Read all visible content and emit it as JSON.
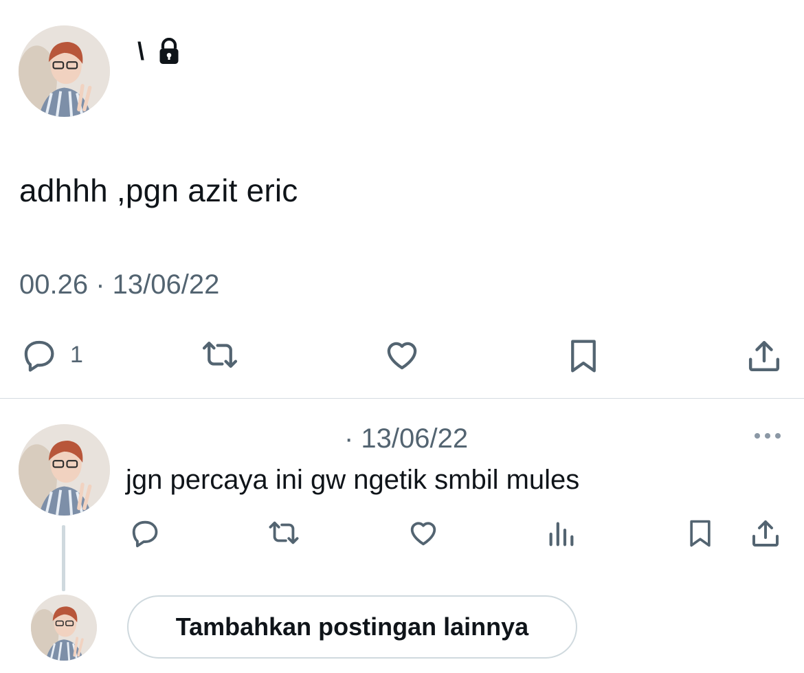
{
  "main_tweet": {
    "display_name": "\\",
    "handle": "",
    "text": "adhhh ,pgn azit eric",
    "meta": "00.26 · 13/06/22",
    "reply_count": "1",
    "icons": {
      "lock": "lock-icon",
      "reply": "reply-icon",
      "repost": "repost-icon",
      "like": "like-icon",
      "bookmark": "bookmark-icon",
      "share": "share-icon"
    }
  },
  "reply": {
    "display_name": "",
    "handle_and_date": "· 13/06/22",
    "text": "jgn percaya ini gw ngetik smbil mules",
    "icons": {
      "more": "more-icon",
      "reply": "reply-icon",
      "repost": "repost-icon",
      "like": "like-icon",
      "views": "views-icon",
      "bookmark": "bookmark-icon",
      "share": "share-icon"
    }
  },
  "composer": {
    "add_post_label": "Tambahkan postingan lainnya"
  },
  "colors": {
    "text_primary": "#0f1419",
    "text_secondary": "#536471",
    "divider": "#d5dbe0",
    "thread_line": "#cfd9de"
  }
}
